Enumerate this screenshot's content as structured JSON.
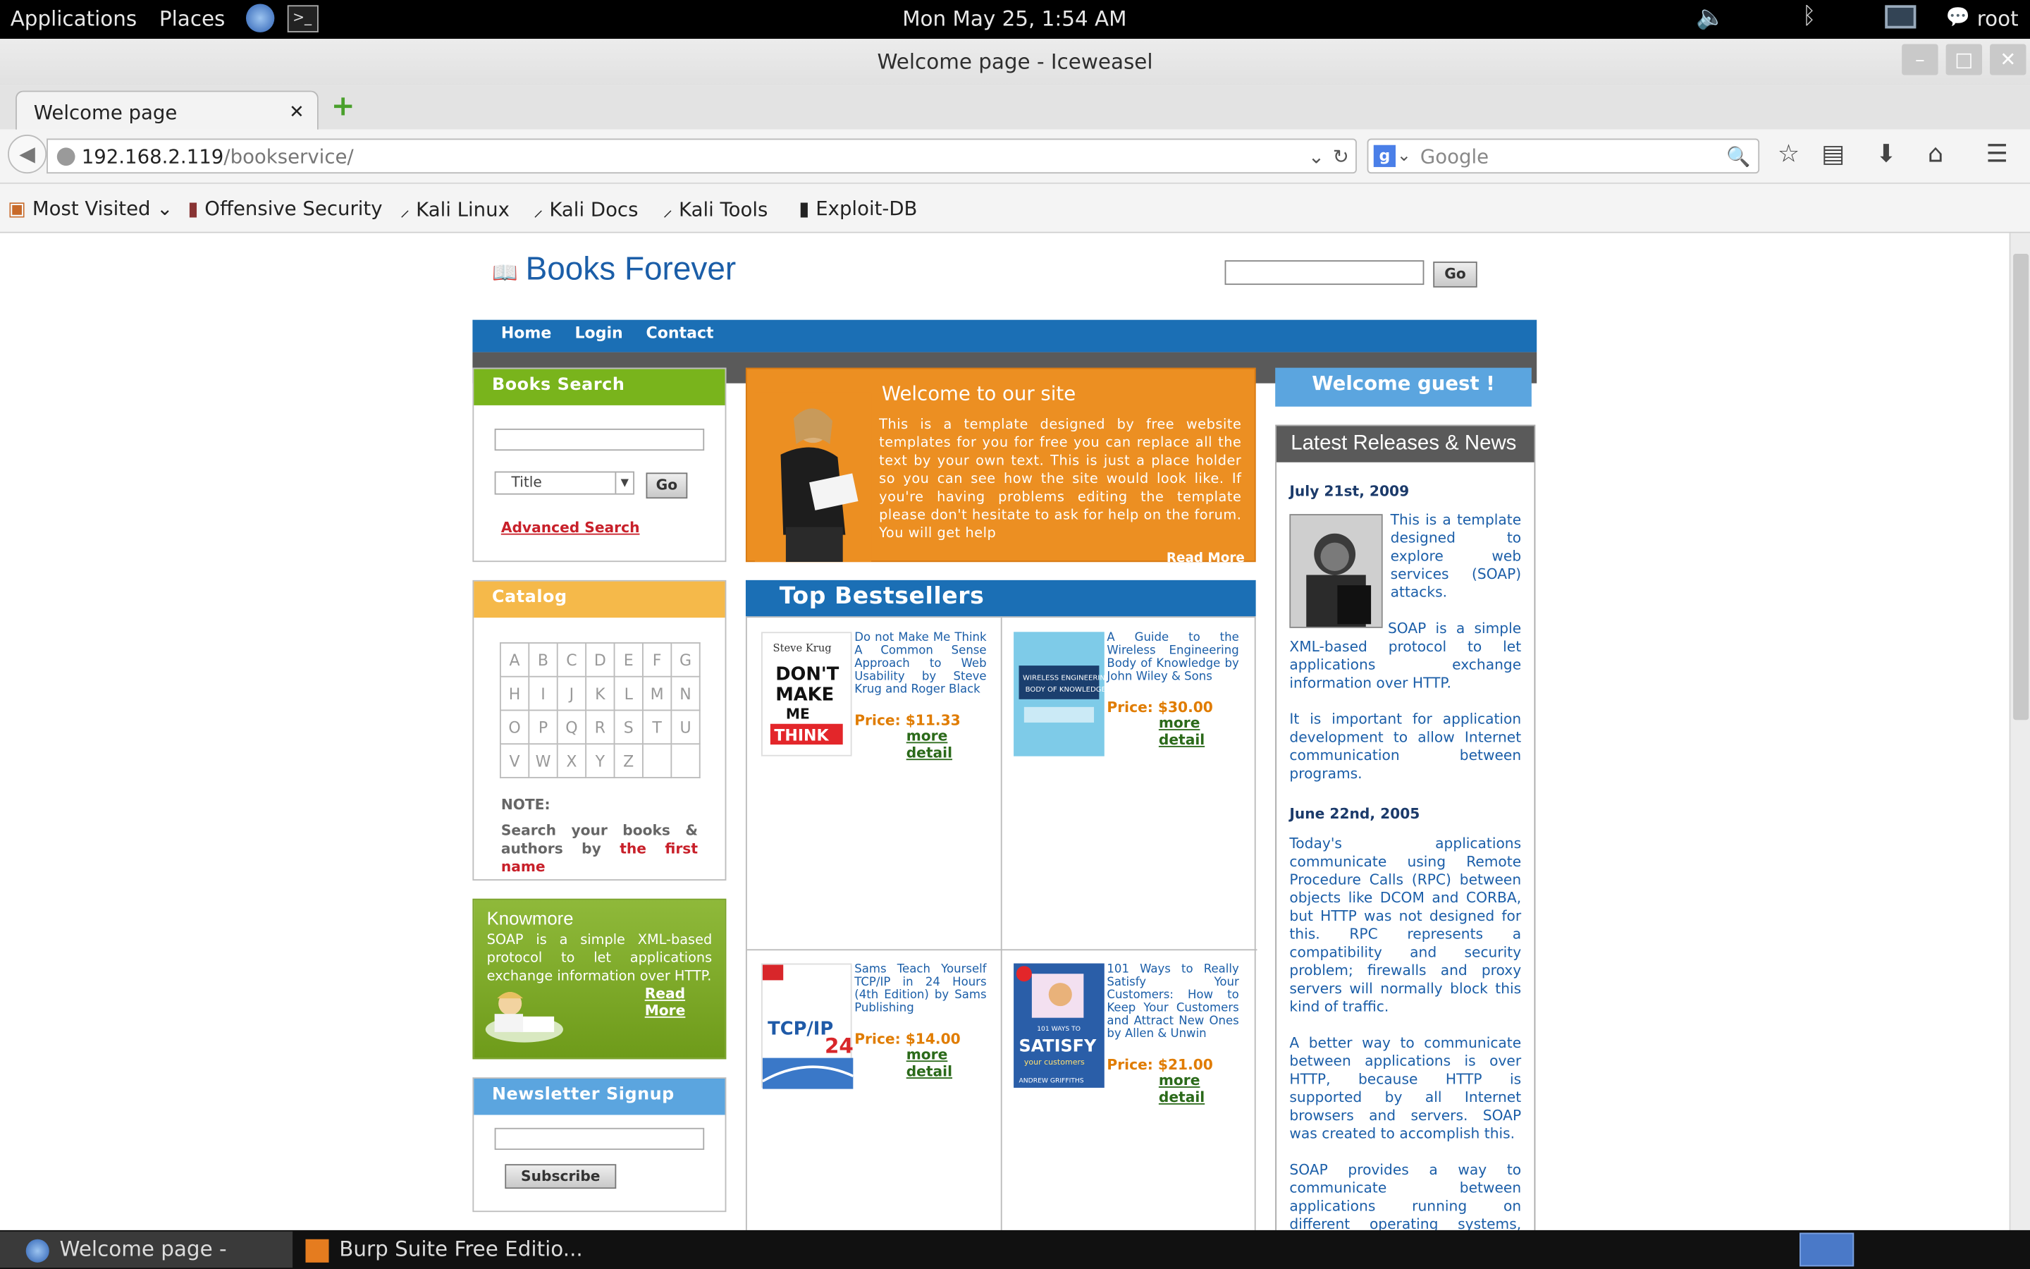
{
  "os": {
    "menu_applications": "Applications",
    "menu_places": "Places",
    "clock": "Mon May 25,  1:54 AM",
    "user": "root"
  },
  "window": {
    "title": "Welcome page - Iceweasel"
  },
  "browser": {
    "tab_title": "Welcome page",
    "url_host": "192.168.2.119",
    "url_path": "/bookservice/",
    "search_placeholder": "Google",
    "bookmarks": [
      "Most Visited",
      "Offensive Security",
      "Kali Linux",
      "Kali Docs",
      "Kali Tools",
      "Exploit-DB"
    ]
  },
  "site": {
    "logo": "Books Forever",
    "go_label": "Go",
    "nav": [
      "Home",
      "Login",
      "Contact"
    ],
    "books_search": {
      "title": "Books Search",
      "select_value": "Title",
      "go_label": "Go",
      "advanced": "Advanced Search"
    },
    "catalog": {
      "title": "Catalog",
      "letters": [
        "A",
        "B",
        "C",
        "D",
        "E",
        "F",
        "G",
        "H",
        "I",
        "J",
        "K",
        "L",
        "M",
        "N",
        "O",
        "P",
        "Q",
        "R",
        "S",
        "T",
        "U",
        "V",
        "W",
        "X",
        "Y",
        "Z"
      ],
      "note_label": "NOTE:",
      "note_text": "Search your books & authors by",
      "note_highlight": "the first name"
    },
    "knowmore": {
      "title": "Knowmore",
      "text": "SOAP is a simple XML-based protocol to let applications exchange information over HTTP.",
      "read_more": "Read More"
    },
    "newsletter": {
      "title": "Newsletter Signup",
      "button": "Subscribe"
    },
    "welcome": {
      "title": "Welcome to our site",
      "text": "This is a template designed by free website templates for you for free you can replace all the text by your own text. This is just a place holder so you can see how the site would look like. If you're having problems editing the template please don't hesitate to ask for help on the forum. You will get help",
      "read_more": "Read More"
    },
    "bestsellers": {
      "title": "Top Bestsellers",
      "more_label": "more detail",
      "books": [
        {
          "title": "Do not Make Me Think A Common Sense Approach to Web Usability by Steve Krug and Roger Black",
          "price": "Price: $11.33",
          "cover_top": "Steve Krug",
          "cover_main": "DON'T MAKE ME THINK"
        },
        {
          "title": "A Guide to the Wireless Engineering Body of Knowledge by John Wiley & Sons",
          "price": "Price: $30.00",
          "cover_main": "WIRELESS ENGINEERING BODY OF KNOWLEDGE"
        },
        {
          "title": "Sams Teach Yourself TCP/IP in 24 Hours (4th Edition) by Sams Publishing",
          "price": "Price: $14.00",
          "cover_main": "TCP/IP",
          "cover_num": "24"
        },
        {
          "title": "101 Ways to Really Satisfy Your Customers: How to Keep Your Customers and Attract New Ones by Allen & Unwin",
          "price": "Price: $21.00",
          "cover_main": "SATISFY",
          "cover_top": "101 WAYS TO",
          "cover_bottom": "ANDREW GRIFFITHS"
        }
      ]
    },
    "welcome_guest": "Welcome guest !",
    "news": {
      "title": "Latest Releases & News",
      "date1": "July 21st, 2009",
      "p1": "This is a template designed to explore web services (SOAP) attacks.",
      "p2": "SOAP is a simple XML-based protocol to let applications exchange information over HTTP.",
      "p3": "It is important for application development to allow Internet communication between programs.",
      "date2": "June 22nd, 2005",
      "p4": "Today's applications communicate using Remote Procedure Calls (RPC) between objects like DCOM and CORBA, but HTTP was not designed for this. RPC represents a compatibility and security problem; firewalls and proxy servers will normally block this kind of traffic.",
      "p5": "A better way to communicate between applications is over HTTP, because HTTP is supported by all Internet browsers and servers. SOAP was created to accomplish this.",
      "p6": "SOAP provides a way to communicate between applications running on different operating systems, with different"
    }
  },
  "taskbar": {
    "task1": "Welcome page - Icew...",
    "task2": "Burp Suite Free Editio..."
  }
}
